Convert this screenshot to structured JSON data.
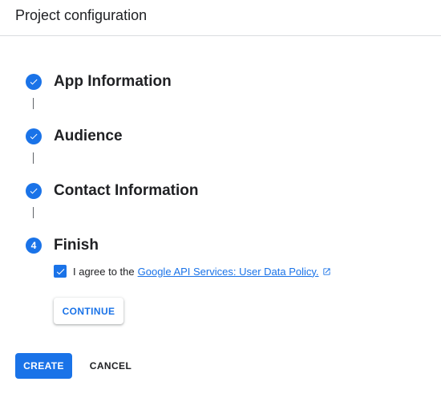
{
  "header": {
    "title": "Project configuration"
  },
  "steps": [
    {
      "label": "App Information",
      "status": "completed",
      "icon": "check-icon"
    },
    {
      "label": "Audience",
      "status": "completed",
      "icon": "check-icon"
    },
    {
      "label": "Contact Information",
      "status": "completed",
      "icon": "check-icon"
    },
    {
      "label": "Finish",
      "status": "current",
      "number": "4"
    }
  ],
  "agreement": {
    "checked": true,
    "text": "I agree to the",
    "link_text": "Google API Services: User Data Policy.",
    "link_icon": "open-in-new-icon"
  },
  "buttons": {
    "continue_label": "CONTINUE",
    "create_label": "CREATE",
    "cancel_label": "CANCEL"
  },
  "colors": {
    "accent": "#1a73e8",
    "text": "#202124",
    "divider": "#dadce0"
  }
}
